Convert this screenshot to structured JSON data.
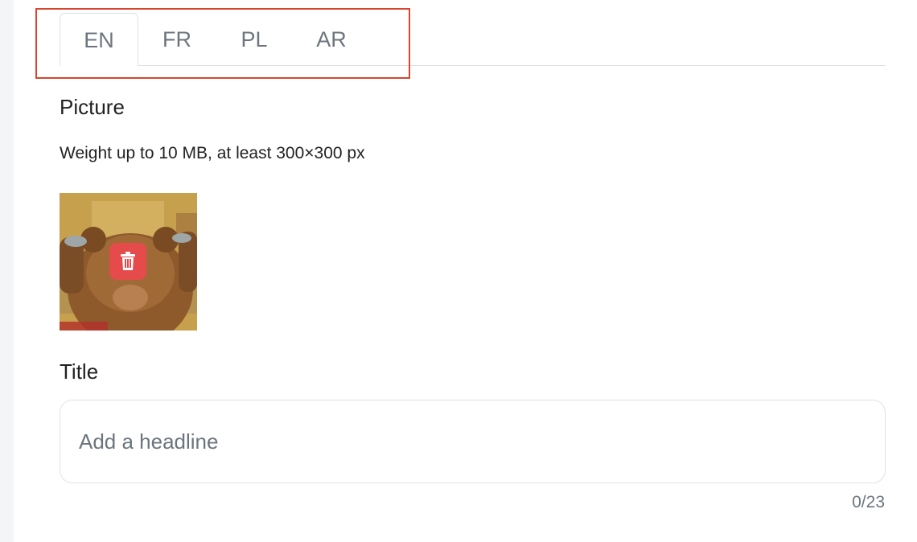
{
  "tabs": [
    {
      "label": "EN",
      "active": true
    },
    {
      "label": "FR",
      "active": false
    },
    {
      "label": "PL",
      "active": false
    },
    {
      "label": "AR",
      "active": false
    }
  ],
  "picture": {
    "label": "Picture",
    "hint": "Weight up to 10 MB, at least 300×300 px",
    "delete_icon": "trash-icon"
  },
  "title": {
    "label": "Title",
    "placeholder": "Add a headline",
    "value": "",
    "counter": "0/23"
  },
  "colors": {
    "highlight": "#d7462e",
    "delete": "#e64b4b",
    "muted_text": "#6c757d",
    "border": "#dcdfe2"
  }
}
